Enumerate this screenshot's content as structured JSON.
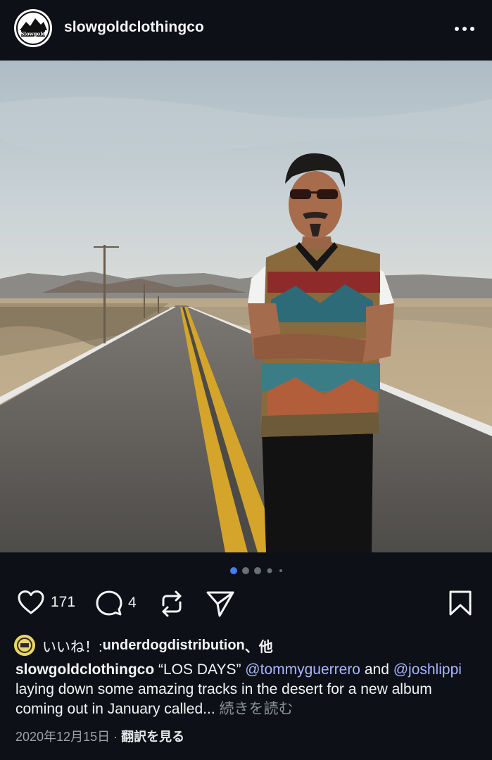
{
  "post": {
    "username": "slowgoldclothingco",
    "avatar_text": "Slowgold",
    "more_label": "•••",
    "carousel": {
      "total": 5,
      "active": 0
    },
    "actions": {
      "like_count": "171",
      "comment_count": "4"
    },
    "likes_line": {
      "prefix": "いいね！: ",
      "user": "underdogdistribution",
      "suffix": "、他"
    },
    "caption": {
      "username": "slowgoldclothingco",
      "text1": " “LOS DAYS” ",
      "mention1": "@tommyguerrero",
      "text2": " and ",
      "mention2": "@joshlippi",
      "text3": " laying down some amazing tracks in the desert for a new album coming out in January called... ",
      "more": "続きを読む"
    },
    "date": "2020年12月15日",
    "separator": " · ",
    "translate": "翻訳を見る"
  },
  "colors": {
    "background": "#0d1016",
    "accent_dot": "#4a7bf7",
    "mention": "#a9b6ff"
  }
}
